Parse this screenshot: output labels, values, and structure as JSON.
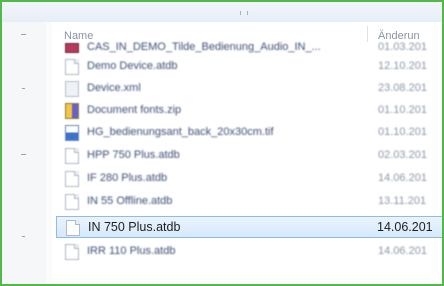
{
  "columns": {
    "name": "Name",
    "date": "Änderun"
  },
  "files": [
    {
      "name": "CAS_IN_DEMO_Tilde_Bedienung_Audio_IN_...",
      "date": "01.03.201",
      "icon": "red-file-icon"
    },
    {
      "name": "Demo Device.atdb",
      "date": "12.10.201",
      "icon": "document-icon"
    },
    {
      "name": "Device.xml",
      "date": "23.08.201",
      "icon": "xml-file-icon"
    },
    {
      "name": "Document fonts.zip",
      "date": "01.10.201",
      "icon": "zip-file-icon"
    },
    {
      "name": "HG_bedienungsant_back_20x30cm.tif",
      "date": "01.10.201",
      "icon": "image-file-icon"
    },
    {
      "name": "HPP 750 Plus.atdb",
      "date": "02.03.201",
      "icon": "document-icon"
    },
    {
      "name": "IF 280 Plus.atdb",
      "date": "14.06.201",
      "icon": "document-icon"
    },
    {
      "name": "IN 55 Offline.atdb",
      "date": "13.11.201",
      "icon": "document-icon"
    },
    {
      "name": "IN 750 Plus.atdb",
      "date": "14.06.201",
      "icon": "document-icon",
      "selected": true
    },
    {
      "name": "IRR 110 Plus.atdb",
      "date": "14.06.201",
      "icon": "document-icon"
    }
  ]
}
